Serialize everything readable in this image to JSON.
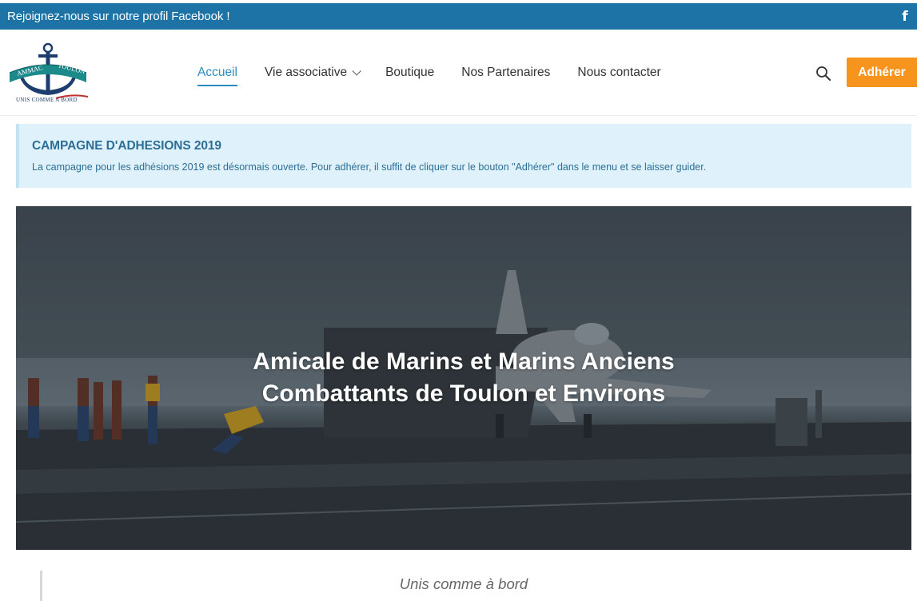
{
  "topbar": {
    "promo": "Rejoignez-nous sur notre profil Facebook !",
    "social_icon": "facebook-icon"
  },
  "logo": {
    "ring_left": "AMMAC",
    "ring_right": "TOULON",
    "motto": "UNIS COMME A BORD"
  },
  "nav": {
    "items": [
      {
        "label": "Accueil",
        "active": true
      },
      {
        "label": "Vie associative",
        "dropdown": true
      },
      {
        "label": "Boutique"
      },
      {
        "label": "Nos Partenaires"
      },
      {
        "label": "Nous contacter"
      }
    ],
    "search_icon": "search-icon",
    "cta_label": "Adhérer"
  },
  "notice": {
    "title": "CAMPAGNE D'ADHESIONS 2019",
    "text": "La campagne pour les adhésions 2019 est désormais ouverte. Pour adhérer, il suffit de cliquer sur le bouton \"Adhérer\" dans le menu et se laisser guider."
  },
  "hero": {
    "title_line1": "Amicale de Marins et Marins Anciens",
    "title_line2": "Combattants de Toulon et Environs"
  },
  "quote": {
    "text": "Unis comme à bord"
  },
  "colors": {
    "topbar": "#1e73a6",
    "accent": "#2b8cbf",
    "cta": "#f7941d",
    "notice_bg": "#dff1fb",
    "notice_text": "#2d6e96"
  }
}
